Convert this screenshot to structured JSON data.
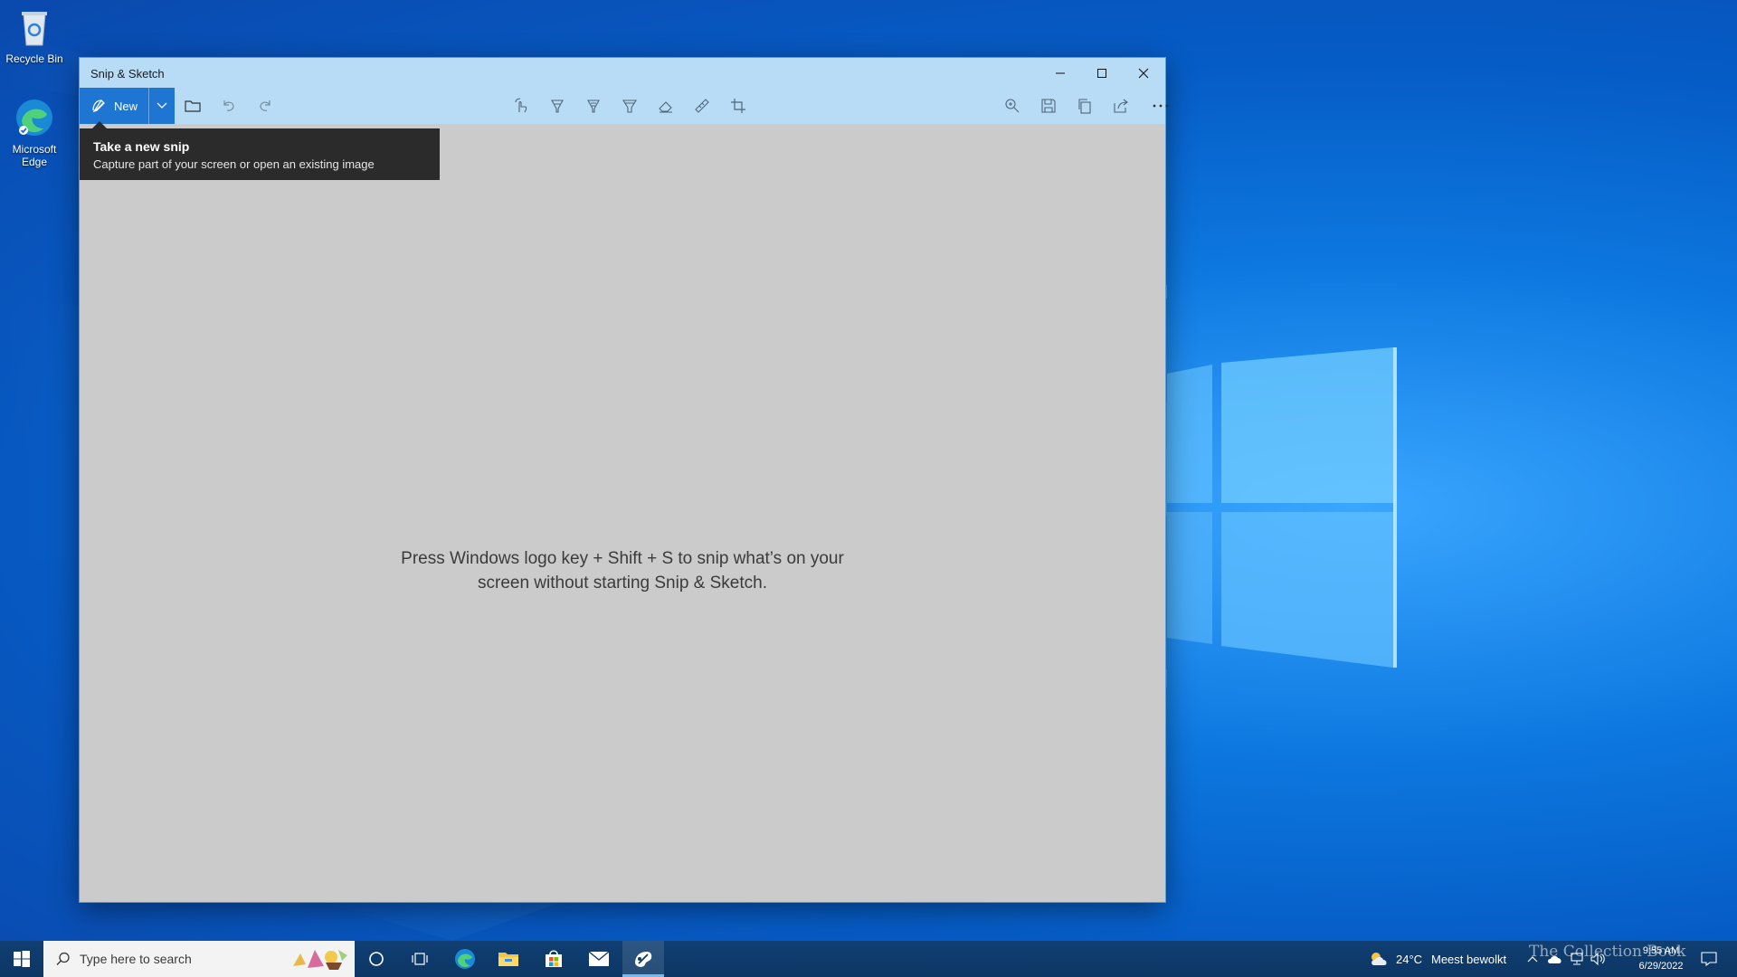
{
  "desktop": {
    "icons": [
      {
        "label": "Recycle Bin"
      },
      {
        "label": "Microsoft Edge"
      }
    ]
  },
  "window": {
    "title": "Snip & Sketch",
    "toolbar": {
      "new_label": "New",
      "icons": [
        "new-snip-icon",
        "chevron-down-icon",
        "folder-icon",
        "undo-icon",
        "redo-icon",
        "touch-writing-icon",
        "ballpoint-pen-icon",
        "pencil-icon",
        "highlighter-icon",
        "eraser-icon",
        "ruler-icon",
        "crop-icon",
        "zoom-icon",
        "save-icon",
        "copy-icon",
        "share-icon",
        "more-icon"
      ]
    },
    "tooltip": {
      "title": "Take a new snip",
      "subtitle": "Capture part of your screen or open an existing image"
    },
    "hint": {
      "line1": "Press Windows logo key + Shift + S to snip what’s on your",
      "line2": "screen without starting Snip & Sketch."
    }
  },
  "taskbar": {
    "search_placeholder": "Type here to search",
    "weather_temp": "24°C",
    "weather_desc": "Meest bewolkt",
    "clock_time": "9:55 AM",
    "clock_date": "6/29/2022",
    "watermark": "The Collection Book"
  },
  "colors": {
    "accent": "#1f76d2",
    "titlebar": "#b9dcf6",
    "canvas": "#cbcbcb",
    "tooltip_bg": "#2b2b2b",
    "taskbar": "#0e3a6b"
  }
}
